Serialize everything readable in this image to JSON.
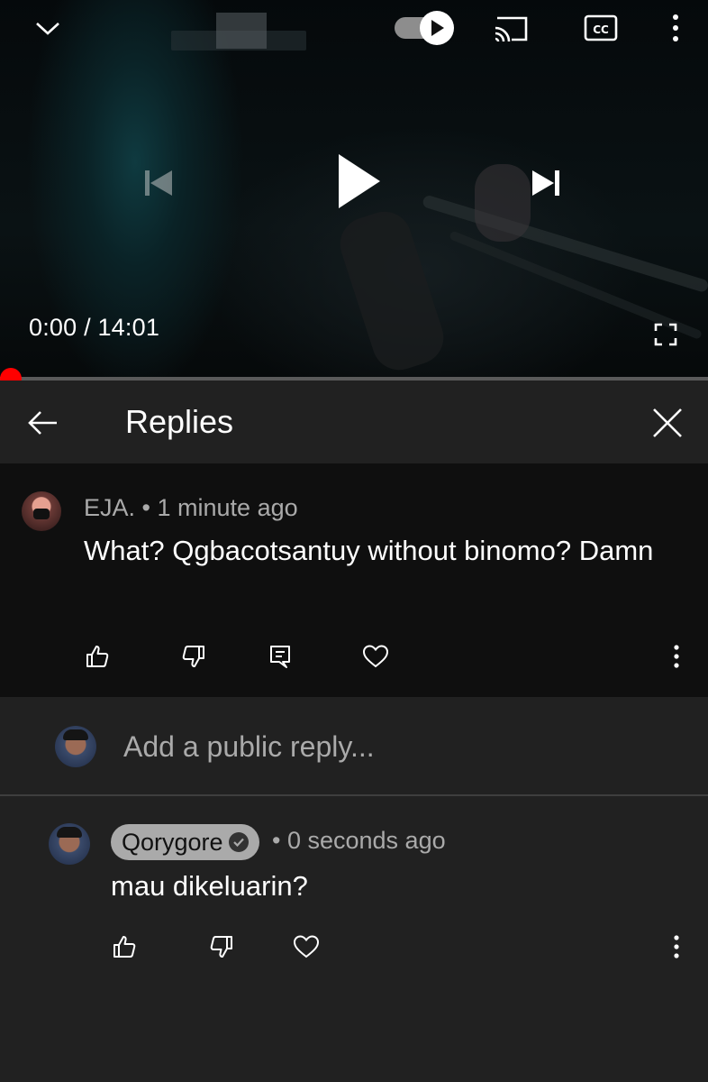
{
  "player": {
    "current_time": "0:00",
    "separator": "/",
    "duration": "14:01",
    "progress_fraction": 0.0,
    "autoplay_on": true,
    "controls": [
      "collapse-icon",
      "autoplay-toggle",
      "cast-icon",
      "cc-icon",
      "more-vert-icon",
      "previous-icon",
      "play-icon",
      "next-icon",
      "fullscreen-icon"
    ]
  },
  "replies_panel": {
    "title": "Replies",
    "back_icon": "arrow-back-icon",
    "close_icon": "close-icon"
  },
  "parent_comment": {
    "author": "EJA.",
    "bullet": "•",
    "time_ago": "1 minute ago",
    "text": "What? Qgbacotsantuy without binomo? Damn",
    "actions": [
      "thumb-up-icon",
      "thumb-down-icon",
      "reply-icon",
      "heart-icon",
      "more-vert-icon"
    ]
  },
  "reply_input": {
    "placeholder": "Add a public reply..."
  },
  "user_reply": {
    "author": "Qorygore",
    "verified": true,
    "bullet": "•",
    "time_ago": "0 seconds ago",
    "text": "mau dikeluarin?",
    "actions": [
      "thumb-up-icon",
      "thumb-down-icon",
      "heart-icon",
      "more-vert-icon"
    ]
  },
  "colors": {
    "background": "#212121",
    "comment_background": "#0f0f0f",
    "secondary_text": "#aaaaaa",
    "progress": "#ff0000",
    "author_chip": "#aaaaaa"
  }
}
